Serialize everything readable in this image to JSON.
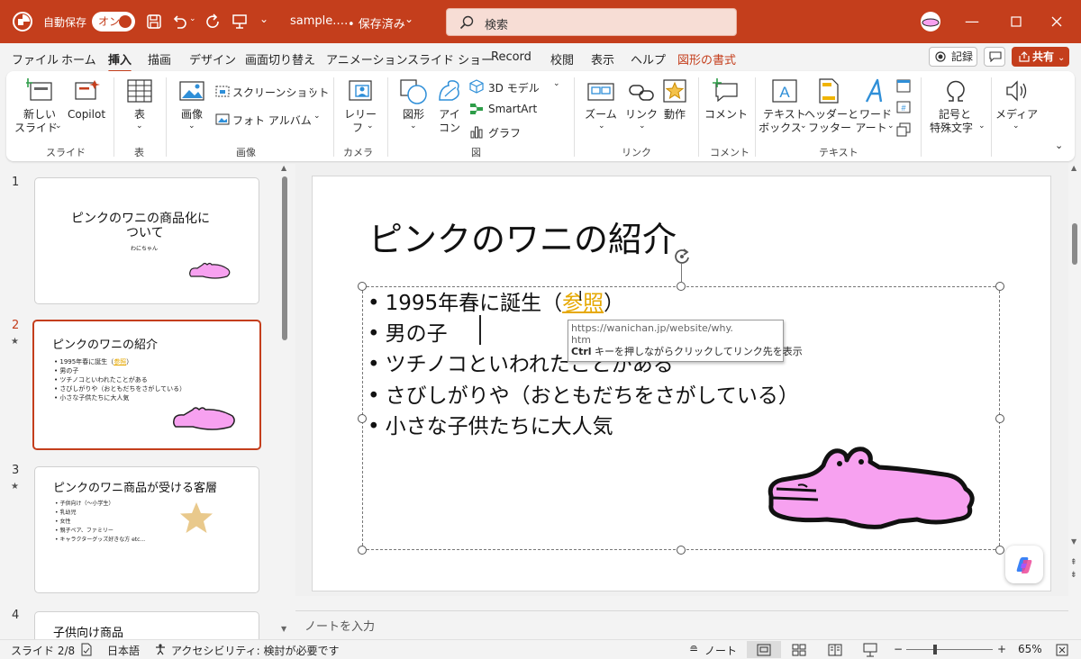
{
  "titlebar": {
    "autosave_label": "自動保存",
    "autosave_state": "オン",
    "filename": "sample.…",
    "save_status": "• 保存済み",
    "search_placeholder": "検索"
  },
  "tabs": [
    "ファイル",
    "ホーム",
    "挿入",
    "描画",
    "デザイン",
    "画面切り替え",
    "アニメーション",
    "スライド ショー",
    "Record",
    "校閲",
    "表示",
    "ヘルプ",
    "図形の書式"
  ],
  "active_tab": "挿入",
  "buttons": {
    "record": "記録",
    "share": "共有"
  },
  "ribbon": {
    "new_slide": [
      "新しい",
      "スライド"
    ],
    "copilot": "Copilot",
    "table": "表",
    "image": "画像",
    "screenshot": "スクリーンショット",
    "photo_album": "フォト アルバム",
    "cameo": [
      "レリー",
      "フ"
    ],
    "shapes": "図形",
    "icons": [
      "アイ",
      "コン"
    ],
    "model3d": "3D モデル",
    "smartart": "SmartArt",
    "chart": "グラフ",
    "zoom": "ズーム",
    "link": "リンク",
    "action": "動作",
    "comment": "コメント",
    "textbox": [
      "テキスト",
      "ボックス"
    ],
    "header_footer": [
      "ヘッダーと",
      "フッター"
    ],
    "wordart": [
      "ワード",
      "アート"
    ],
    "symbols": [
      "記号と",
      "特殊文字"
    ],
    "media": "メディア",
    "groups": [
      "スライド",
      "表",
      "画像",
      "カメラ",
      "図",
      "リンク",
      "コメント",
      "テキスト"
    ]
  },
  "thumbnails": [
    {
      "num": "1",
      "title": "ピンクのワニの商品化に",
      "title2": "ついて",
      "subtitle": "わにちゃん"
    },
    {
      "num": "2",
      "title": "ピンクのワニの紹介",
      "bullets": [
        "1995年春に誕生（",
        "参照",
        "）",
        "男の子",
        "ツチノコといわれたことがある",
        "さびしがりや（おともだちをさがしている）",
        "小さな子供たちに大人気"
      ]
    },
    {
      "num": "3",
      "title": "ピンクのワニ商品が受ける客層",
      "bullets": [
        "子供向け（～小学生）",
        "乳幼児",
        "女性",
        "親子ペア、ファミリー",
        "キャラクターグッズ好きな方 etc..."
      ]
    },
    {
      "num": "4",
      "title": "子供向け商品"
    }
  ],
  "slide": {
    "title": "ピンクのワニの紹介",
    "bullet_char": "•",
    "b1_pre": "1995年春に誕生（",
    "b1_link": "参照",
    "b1_post": "）",
    "b2": "男の子",
    "b3": "ツチノコといわれたことがある",
    "b4": "さびしがりや（おともだちをさがしている）",
    "b5": "小さな子供たちに大人気"
  },
  "tooltip": {
    "url_line1": "https://wanichan.jp/website/why.",
    "url_line2": "htm",
    "hint_key": "Ctrl",
    "hint_text": " キーを押しながらクリックしてリンク先を表示"
  },
  "notes_placeholder": "ノートを入力",
  "status": {
    "slide_counter": "スライド 2/8",
    "language": "日本語",
    "accessibility": "アクセシビリティ: 検討が必要です",
    "notes": "ノート",
    "zoom": "65%"
  },
  "colors": {
    "accent": "#c43e1c",
    "link": "#e6a800",
    "croc": "#f7a1f0",
    "star": "#e9c98c"
  }
}
